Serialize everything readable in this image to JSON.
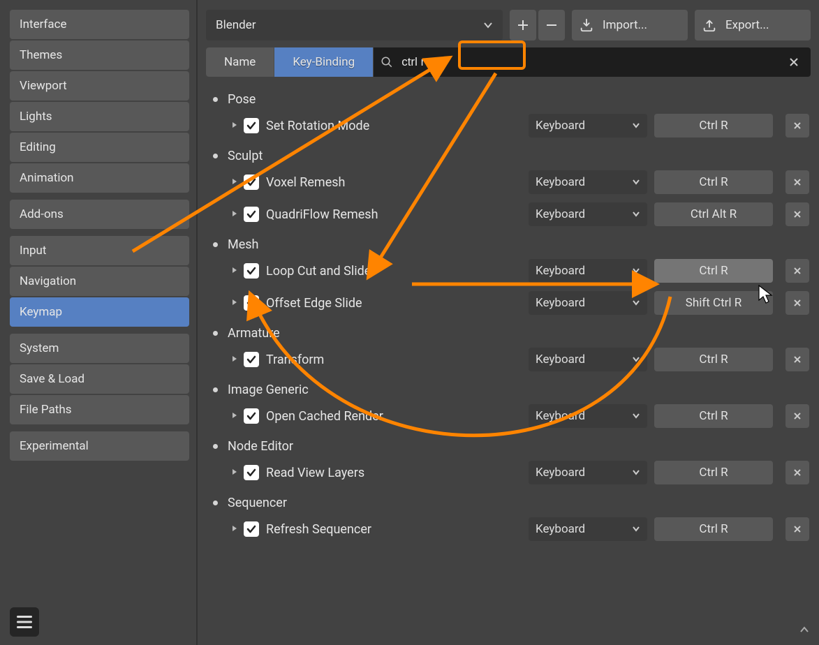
{
  "sidebar": {
    "groups": [
      [
        "Interface",
        "Themes",
        "Viewport",
        "Lights",
        "Editing",
        "Animation"
      ],
      [
        "Add-ons"
      ],
      [
        "Input",
        "Navigation",
        "Keymap"
      ],
      [
        "System",
        "Save & Load",
        "File Paths"
      ],
      [
        "Experimental"
      ]
    ],
    "active": "Keymap"
  },
  "preset": "Blender",
  "import": "Import...",
  "export": "Export...",
  "filter": {
    "name": "Name",
    "key": "Key-Binding",
    "active": "key"
  },
  "search": {
    "value": "ctrl r"
  },
  "defaultInput": "Keyboard",
  "sections": [
    {
      "name": "Pose",
      "rows": [
        {
          "label": "Set Rotation Mode",
          "shortcut": "Ctrl R"
        }
      ]
    },
    {
      "name": "Sculpt",
      "rows": [
        {
          "label": "Voxel Remesh",
          "shortcut": "Ctrl R"
        },
        {
          "label": "QuadriFlow Remesh",
          "shortcut": "Ctrl Alt R"
        }
      ]
    },
    {
      "name": "Mesh",
      "rows": [
        {
          "label": "Loop Cut and Slide",
          "shortcut": "Ctrl R",
          "highlight": true
        },
        {
          "label": "Offset Edge Slide",
          "shortcut": "Shift Ctrl R"
        }
      ]
    },
    {
      "name": "Armature",
      "rows": [
        {
          "label": "Transform",
          "shortcut": "Ctrl R"
        }
      ]
    },
    {
      "name": "Image Generic",
      "rows": [
        {
          "label": "Open Cached Render",
          "shortcut": "Ctrl R"
        }
      ]
    },
    {
      "name": "Node Editor",
      "rows": [
        {
          "label": "Read View Layers",
          "shortcut": "Ctrl R"
        }
      ]
    },
    {
      "name": "Sequencer",
      "rows": [
        {
          "label": "Refresh Sequencer",
          "shortcut": "Ctrl R"
        }
      ]
    }
  ]
}
